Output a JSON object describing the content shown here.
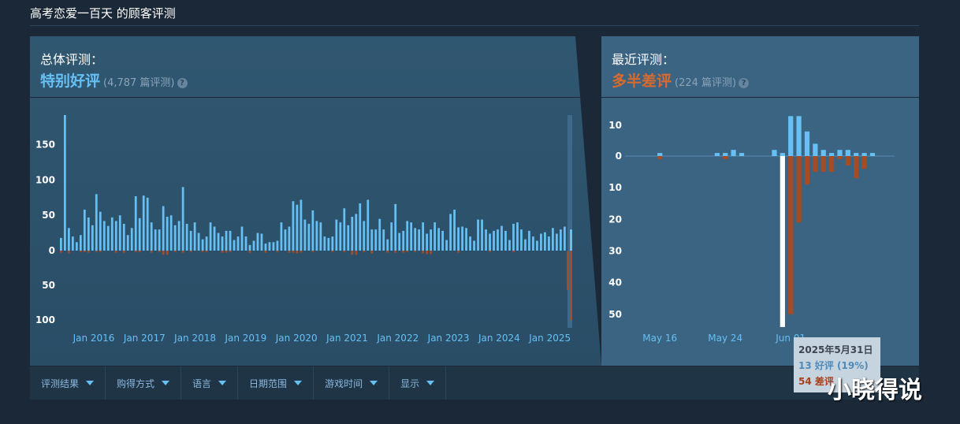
{
  "header": {
    "title": "高考恋爱一百天 的顾客评测"
  },
  "overall": {
    "label": "总体评测：",
    "verdict": "特别好评",
    "count": "(4,787 篇评测)",
    "help_icon": "?"
  },
  "recent": {
    "label": "最近评测：",
    "verdict": "多半差评",
    "count": "(224 篇评测)",
    "help_icon": "?"
  },
  "filters": [
    "评测结果",
    "购得方式",
    "语言",
    "日期范围",
    "游戏时间",
    "显示"
  ],
  "tooltip": {
    "date": "2025年5月31日",
    "positive": "13 好评 (19%)",
    "negative": "54 差评"
  },
  "watermark": "小晓得说",
  "colors": {
    "positive": "#66c0f4",
    "negative": "#a34c25",
    "highlight": "#ffffff"
  },
  "chart_data": [
    {
      "type": "bar",
      "y_ticks_up": [
        "150",
        "100",
        "50",
        "0"
      ],
      "y_ticks_down": [
        "50",
        "100"
      ],
      "ylim": [
        -110,
        195
      ],
      "x_labels": [
        "Jan 2016",
        "Jan 2017",
        "Jan 2018",
        "Jan 2019",
        "Jan 2020",
        "Jan 2021",
        "Jan 2022",
        "Jan 2023",
        "Jan 2024",
        "Jan 2025"
      ],
      "positive": [
        18,
        192,
        32,
        20,
        12,
        22,
        58,
        47,
        36,
        80,
        55,
        42,
        35,
        47,
        42,
        50,
        38,
        22,
        32,
        77,
        46,
        78,
        75,
        40,
        30,
        30,
        63,
        48,
        50,
        36,
        42,
        90,
        38,
        28,
        40,
        25,
        16,
        20,
        40,
        34,
        25,
        20,
        28,
        28,
        15,
        20,
        34,
        20,
        8,
        14,
        25,
        24,
        10,
        12,
        12,
        14,
        40,
        30,
        34,
        70,
        65,
        72,
        44,
        38,
        57,
        42,
        40,
        20,
        18,
        20,
        44,
        40,
        60,
        36,
        48,
        52,
        67,
        42,
        72,
        30,
        30,
        45,
        30,
        16,
        40,
        66,
        25,
        28,
        42,
        40,
        32,
        30,
        40,
        24,
        30,
        40,
        32,
        28,
        15,
        52,
        58,
        33,
        34,
        32,
        20,
        14,
        44,
        44,
        30,
        24,
        28,
        30,
        35,
        28,
        15,
        38,
        40,
        30,
        16,
        28,
        20,
        14,
        24,
        26,
        20,
        32,
        24,
        30,
        34
      ],
      "negative": [
        3,
        0,
        4,
        0,
        0,
        2,
        2,
        3,
        0,
        2,
        2,
        0,
        0,
        0,
        3,
        0,
        3,
        0,
        0,
        2,
        2,
        0,
        0,
        3,
        0,
        2,
        6,
        6,
        0,
        2,
        0,
        3,
        0,
        2,
        0,
        0,
        2,
        2,
        0,
        0,
        0,
        3,
        3,
        2,
        0,
        0,
        0,
        0,
        3,
        0,
        0,
        0,
        3,
        0,
        0,
        2,
        0,
        0,
        3,
        3,
        4,
        3,
        0,
        0,
        2,
        0,
        0,
        0,
        0,
        2,
        0,
        0,
        2,
        0,
        6,
        6,
        0,
        2,
        0,
        4,
        0,
        0,
        0,
        3,
        0,
        3,
        0,
        3,
        2,
        0,
        2,
        0,
        4,
        5,
        5,
        0,
        0,
        0,
        0,
        0,
        0,
        3,
        0,
        0,
        0,
        0,
        0,
        0,
        0,
        2,
        0,
        0,
        0,
        0,
        0,
        2,
        0,
        0,
        0,
        0,
        0,
        0,
        0,
        0,
        0,
        0,
        0,
        0,
        0
      ],
      "recent_positive": 150,
      "recent_negative": 100
    },
    {
      "type": "bar",
      "y_ticks_up": [
        "10",
        "0"
      ],
      "y_ticks_down": [
        "10",
        "20",
        "30",
        "40",
        "50"
      ],
      "ylim": [
        -54,
        13
      ],
      "x_labels": [
        "May 16",
        "May 24",
        "Jun 01"
      ],
      "x_label_dates": [
        "May 16",
        "May 24",
        "Jun 01"
      ],
      "dates": [
        "May 13",
        "May 14",
        "May 15",
        "May 16",
        "May 17",
        "May 18",
        "May 19",
        "May 20",
        "May 21",
        "May 22",
        "May 23",
        "May 24",
        "May 25",
        "May 26",
        "May 27",
        "May 28",
        "May 29",
        "May 30",
        "May 31",
        "Jun 01",
        "Jun 02",
        "Jun 03",
        "Jun 04",
        "Jun 05",
        "Jun 06",
        "Jun 07",
        "Jun 08",
        "Jun 09",
        "Jun 10",
        "Jun 11",
        "Jun 12",
        "Jun 13"
      ],
      "positive": [
        0,
        0,
        0,
        1,
        0,
        0,
        0,
        0,
        0,
        0,
        1,
        1,
        2,
        1,
        0,
        0,
        0,
        2,
        1,
        13,
        13,
        8,
        4,
        2,
        1,
        2,
        2,
        1,
        1,
        1,
        0,
        0
      ],
      "negative": [
        0,
        0,
        0,
        1,
        0,
        0,
        0,
        0,
        0,
        0,
        0,
        1,
        0,
        0,
        0,
        0,
        0,
        0,
        54,
        50,
        21,
        9,
        5,
        5,
        5,
        1,
        3,
        7,
        4,
        0,
        0,
        0
      ],
      "highlight_date": "May 31"
    }
  ]
}
